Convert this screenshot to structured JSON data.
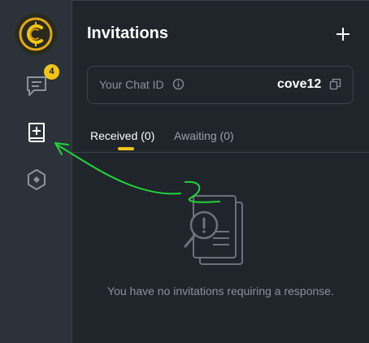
{
  "sidebar": {
    "badge_count": "4",
    "items": [
      {
        "name": "chat-icon"
      },
      {
        "name": "add-contact-icon"
      },
      {
        "name": "hex-diamond-icon"
      }
    ]
  },
  "header": {
    "title": "Invitations"
  },
  "chat_id": {
    "label": "Your Chat ID",
    "value": "cove12"
  },
  "tabs": [
    {
      "label": "Received (0)",
      "active": true
    },
    {
      "label": "Awaiting (0)",
      "active": false
    }
  ],
  "empty_state": {
    "message": "You have no invitations requiring a response."
  },
  "colors": {
    "accent": "#f0c419",
    "rail_bg": "#2b323a",
    "main_bg": "#1f252b",
    "annotation": "#22d43a"
  }
}
